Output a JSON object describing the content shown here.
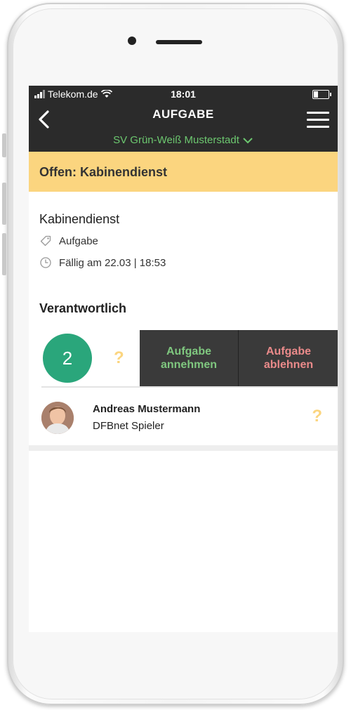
{
  "status_bar": {
    "carrier": "Telekom.de",
    "time": "18:01",
    "battery_level": 0.35
  },
  "nav": {
    "title": "AUFGABE",
    "club": "SV Grün-Weiß Musterstadt"
  },
  "banner": {
    "text": "Offen: Kabinendienst"
  },
  "task": {
    "name": "Kabinendienst",
    "type": "Aufgabe",
    "due": "Fällig am 22.03 | 18:53"
  },
  "responsible": {
    "heading": "Verantwortlich",
    "count": "2",
    "status_symbol": "?",
    "accept_line1": "Aufgabe",
    "accept_line2": "annehmen",
    "decline_line1": "Aufgabe",
    "decline_line2": "ablehnen"
  },
  "members": [
    {
      "name": "Andreas Mustermann",
      "role": "DFBnet Spieler",
      "status": "?"
    }
  ],
  "colors": {
    "bar_bg": "#2b2b2b",
    "banner": "#fbd57f",
    "accent_green": "#6cc76f",
    "badge_green": "#2aa67b",
    "decline_red": "#ea8a8a"
  },
  "icons": {
    "back": "chevron-left-icon",
    "menu": "hamburger-menu-icon",
    "club": "chevron-down-icon",
    "type": "tag-icon",
    "due": "clock-icon"
  }
}
